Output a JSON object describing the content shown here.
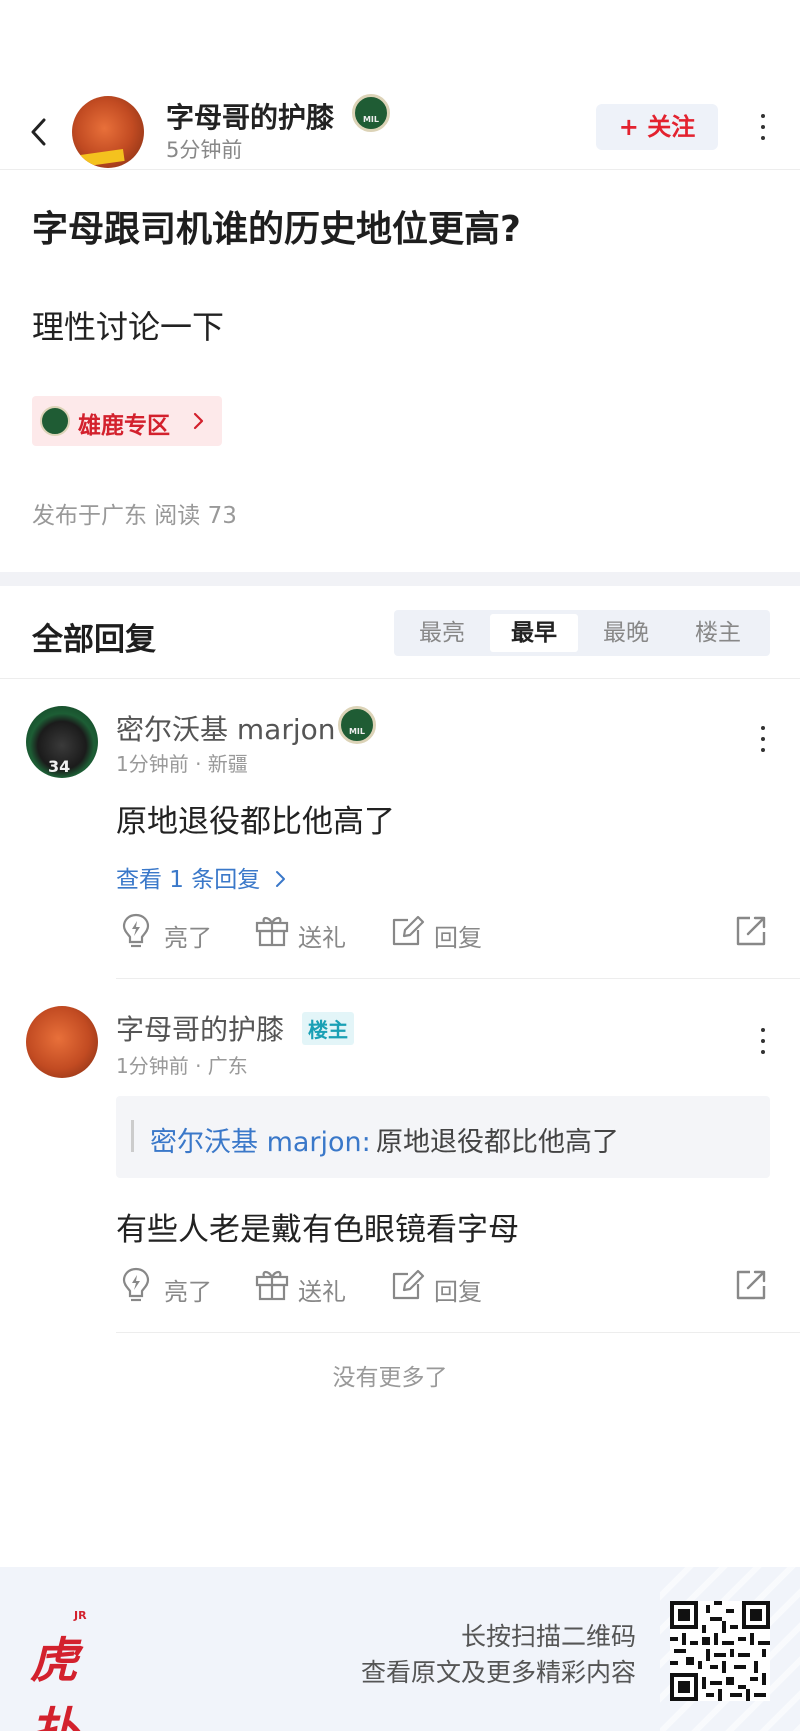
{
  "header": {
    "author": "字母哥的护膝",
    "time": "5分钟前",
    "follow_label": "+ 关注"
  },
  "post": {
    "title": "字母跟司机谁的历史地位更高?",
    "body": "理性讨论一下",
    "zone_label": "雄鹿专区",
    "meta": "发布于广东  阅读 73"
  },
  "replies": {
    "title": "全部回复",
    "sort_tabs": [
      "最亮",
      "最早",
      "最晚",
      "楼主"
    ],
    "active_tab": "最早",
    "items": [
      {
        "author": "密尔沃基 marjon",
        "time": "1分钟前 · 新疆",
        "text": "原地退役都比他高了",
        "view_replies": "查看 1 条回复",
        "actions": [
          "亮了",
          "送礼",
          "回复"
        ]
      },
      {
        "author": "字母哥的护膝",
        "op_badge": "楼主",
        "time": "1分钟前 · 广东",
        "quote_name": "密尔沃基 marjon:",
        "quote_text": "原地退役都比他高了",
        "text": "有些人老是戴有色眼镜看字母",
        "actions": [
          "亮了",
          "送礼",
          "回复"
        ]
      }
    ],
    "no_more": "没有更多了"
  },
  "footer": {
    "logo_small": "JR",
    "logo_text": "虎扑",
    "line1": "长按扫描二维码",
    "line2": "查看原文及更多精彩内容"
  },
  "colors": {
    "accent_red": "#e3222f",
    "link_blue": "#3a78c9",
    "op_teal": "#1aa0b5",
    "bucks_green": "#1f5c34"
  }
}
